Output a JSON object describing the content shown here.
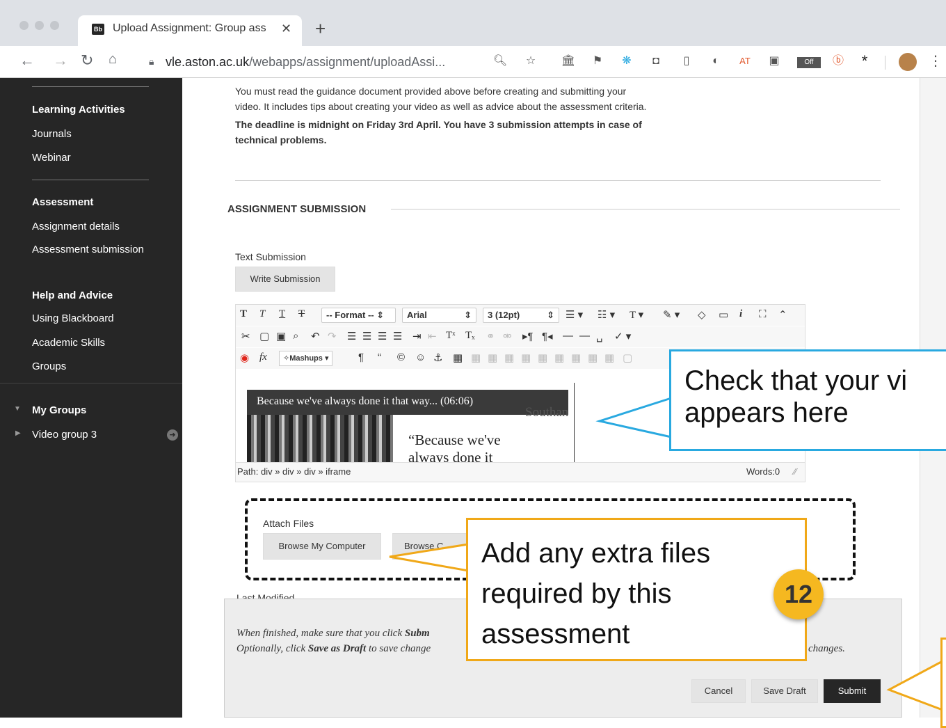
{
  "browser": {
    "tab_title": "Upload Assignment: Group ass",
    "tab_favicon": "Bb",
    "tab_close": "✕",
    "new_tab": "+",
    "url_host": "vle.aston.ac.uk",
    "url_path": "/webapps/assignment/uploadAssi...",
    "ext_at": "AT",
    "ext_off": "Off"
  },
  "sidebar": {
    "sections": [
      {
        "heading": "Learning Activities",
        "items": [
          "Journals",
          "Webinar"
        ]
      },
      {
        "heading": "Assessment",
        "items": [
          "Assignment details",
          "Assessment submission"
        ]
      },
      {
        "heading": "Help and Advice",
        "items": [
          "Using Blackboard",
          "Academic Skills",
          "Groups"
        ]
      }
    ],
    "my_groups": "My Groups",
    "group_item": "Video group 3"
  },
  "content": {
    "intro_line1": "You must read the guidance document provided above before creating and submitting your",
    "intro_line2": "video. It includes tips about creating your video as well as advice about the assessment criteria.",
    "deadline_line1": "The deadline is midnight on Friday 3rd April. You have 3 submission attempts in case of",
    "deadline_line2": "technical problems.",
    "section_title": "ASSIGNMENT SUBMISSION",
    "text_submission_label": "Text Submission",
    "write_submission_button": "Write Submission"
  },
  "editor": {
    "format_select": "-- Format --",
    "font_select": "Arial",
    "size_select": "3 (12pt)",
    "mashups": "Mashups",
    "video_title": "Because we've always done it that way... (06:06)",
    "video_quote_line1": "“Because we've",
    "video_quote_line2": "always done it",
    "video_brand": "Southampton",
    "path_text": "Path: div » div » div » iframe",
    "words_text": "Words:0"
  },
  "attach": {
    "label": "Attach Files",
    "browse_computer": "Browse My Computer",
    "browse_content": "Browse C"
  },
  "submit_panel": {
    "last_modified": "Last Modified",
    "line1_pre": "When finished, make sure that you click ",
    "line1_bold": "Subm",
    "line2_pre": "Optionally, click ",
    "line2_bold": "Save as Draft",
    "line2_post": " to save change",
    "line2_tail": "changes.",
    "cancel": "Cancel",
    "save_draft": "Save Draft",
    "submit": "Submit"
  },
  "callouts": {
    "blue_line1": "Check that your vi",
    "blue_line2": "appears here",
    "orange_line1": "Add any extra files",
    "orange_line2": "required by this",
    "orange_line3": "assessment",
    "step_number": "12"
  },
  "colors": {
    "callout_blue": "#29a9e0",
    "callout_orange": "#f0a818",
    "badge": "#f5b820",
    "sidebar_bg": "#262626"
  }
}
